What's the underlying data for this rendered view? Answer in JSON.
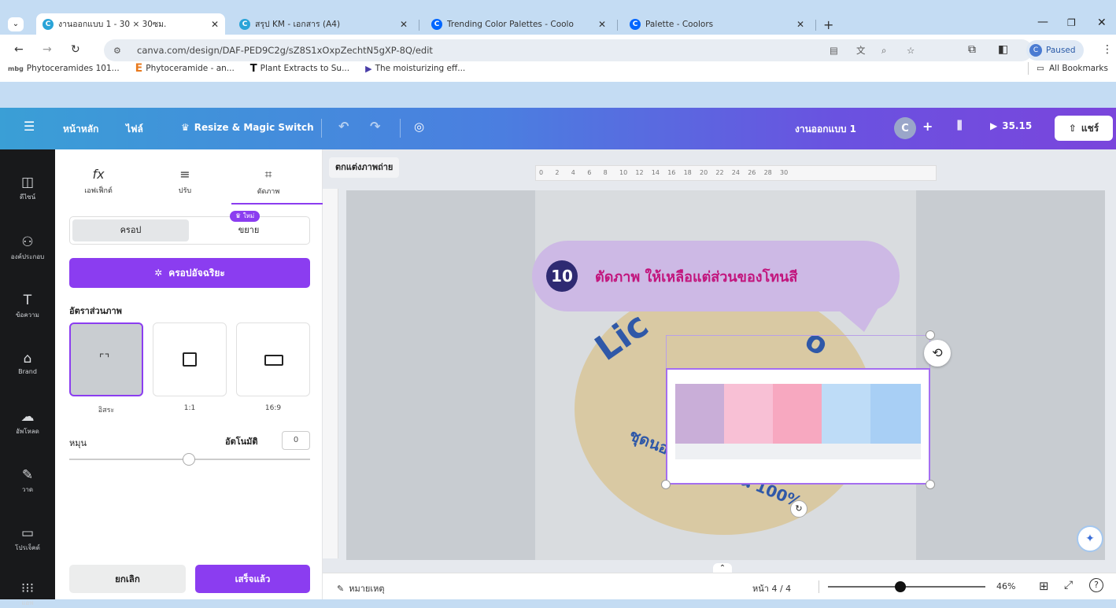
{
  "browser": {
    "tabs": [
      {
        "title": "งานออกแบบ 1 - 30 × 30ซม.",
        "icon": "canva-icon",
        "color": "#2aa4d8",
        "active": true
      },
      {
        "title": "สรุป KM - เอกสาร (A4)",
        "icon": "canva-icon",
        "color": "#2aa4d8",
        "active": false
      },
      {
        "title": "Trending Color Palettes - Coolo",
        "icon": "coolors-icon",
        "color": "#0066ff",
        "active": false
      },
      {
        "title": "Palette - Coolors",
        "icon": "coolors-icon",
        "color": "#0066ff",
        "active": false
      }
    ],
    "new_tab": "+",
    "url": "canva.com/design/DAF-PED9C2g/sZ8S1xOxpZechtN5gXP-8Q/edit",
    "profile_status": "Paused",
    "bookmarks": [
      {
        "label": "Phytoceramides 101...",
        "icon": "mbg"
      },
      {
        "label": "Phytoceramide - an...",
        "icon": "E"
      },
      {
        "label": "Plant Extracts to Su...",
        "icon": "T"
      },
      {
        "label": "The moisturizing eff...",
        "icon": "D"
      }
    ],
    "all_bookmarks": "All Bookmarks"
  },
  "canva": {
    "menu_home": "หน้าหลัก",
    "menu_file": "ไฟล์",
    "menu_resize": "Resize & Magic Switch",
    "design_name": "งานออกแบบ 1",
    "avatar_letter": "C",
    "present_time": "35.15",
    "share": "แชร์",
    "edit_photo_label": "ตกแต่งภาพถ่าย"
  },
  "rail": [
    {
      "label": "ดีไซน์",
      "icon": "layout-icon"
    },
    {
      "label": "องค์ประกอบ",
      "icon": "elements-icon"
    },
    {
      "label": "ข้อความ",
      "icon": "text-icon"
    },
    {
      "label": "Brand",
      "icon": "brand-icon"
    },
    {
      "label": "อัพโหลด",
      "icon": "upload-icon"
    },
    {
      "label": "วาด",
      "icon": "draw-icon"
    },
    {
      "label": "โปรเจ็คต์",
      "icon": "folder-icon"
    },
    {
      "label": "แอพ",
      "icon": "apps-icon"
    }
  ],
  "panel": {
    "tabs": [
      {
        "label": "เอฟเฟ็กต์",
        "glyph": "fx"
      },
      {
        "label": "ปรับ",
        "glyph": "≡"
      },
      {
        "label": "ตัดภาพ",
        "glyph": "⌗"
      }
    ],
    "seg_crop": "ครอป",
    "seg_expand": "ขยาย",
    "new_badge": "ใหม่",
    "magic_crop": "ครอปอัจฉริยะ",
    "aspect_title": "อัตราส่วนภาพ",
    "ratios": [
      {
        "label": "อิสระ"
      },
      {
        "label": "1:1"
      },
      {
        "label": "16:9"
      }
    ],
    "rotate_label": "หมุน",
    "auto_label": "อัตโนมัติ",
    "rotate_value": "0",
    "cancel": "ยกเลิก",
    "done": "เสร็จแล้ว"
  },
  "canvas": {
    "step_number": "10",
    "step_text": "ตัดภาพ ให้เหลือแต่ส่วนของโทนสี",
    "circle_text": "ชุดนอนผ้าคอตตอน 100%",
    "palette_colors": [
      "#c9aed8",
      "#f8c0d5",
      "#f7a8c0",
      "#bedcf7",
      "#a8cff5"
    ],
    "ruler_ticks": [
      "0",
      "2",
      "4",
      "6",
      "8",
      "10",
      "12",
      "14",
      "16",
      "18",
      "20",
      "22",
      "24",
      "26",
      "28",
      "30"
    ]
  },
  "footer": {
    "notes": "หมายเหตุ",
    "page": "หน้า 4 / 4",
    "zoom": "46%",
    "zoom_fraction": 0.46
  }
}
